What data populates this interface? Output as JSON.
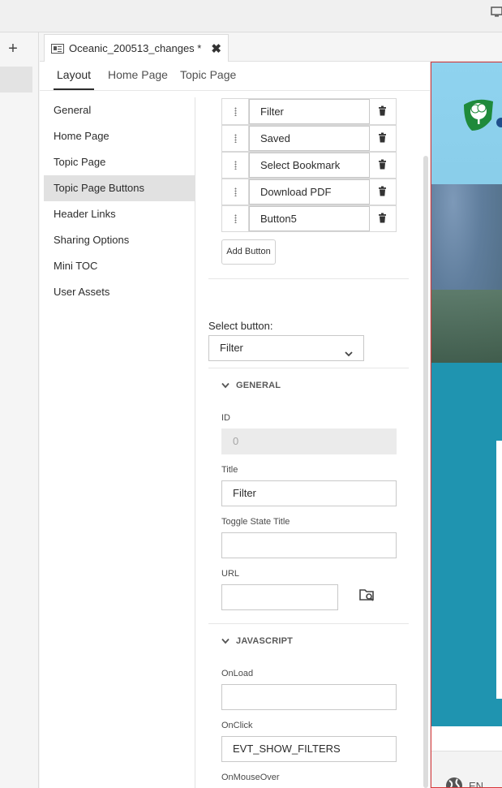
{
  "doc_tab": {
    "title": "Oceanic_200513_changes *",
    "close_label": "✖"
  },
  "subtabs": [
    {
      "label": "Layout",
      "active": true
    },
    {
      "label": "Home Page",
      "active": false
    },
    {
      "label": "Topic Page",
      "active": false
    }
  ],
  "leftnav": {
    "items": [
      {
        "label": "General",
        "active": false
      },
      {
        "label": "Home Page",
        "active": false
      },
      {
        "label": "Topic Page",
        "active": false
      },
      {
        "label": "Topic Page Buttons",
        "active": true
      },
      {
        "label": "Header Links",
        "active": false
      },
      {
        "label": "Sharing Options",
        "active": false
      },
      {
        "label": "Mini TOC",
        "active": false
      },
      {
        "label": "User Assets",
        "active": false
      }
    ]
  },
  "buttons": [
    {
      "label": "Filter"
    },
    {
      "label": "Saved"
    },
    {
      "label": "Select Bookmark"
    },
    {
      "label": "Download PDF"
    },
    {
      "label": "Button5"
    }
  ],
  "add_button_label": "Add Button",
  "select_button": {
    "label": "Select button:",
    "value": "Filter"
  },
  "general_section": {
    "heading": "GENERAL",
    "id_label": "ID",
    "id_value": "0",
    "title_label": "Title",
    "title_value": "Filter",
    "toggle_state_title_label": "Toggle State Title",
    "toggle_state_title_value": "",
    "url_label": "URL",
    "url_value": ""
  },
  "javascript_section": {
    "heading": "JAVASCRIPT",
    "onload_label": "OnLoad",
    "onload_value": "",
    "onclick_label": "OnClick",
    "onclick_value": "EVT_SHOW_FILTERS",
    "onmouseover_label": "OnMouseOver",
    "onmouseover_value": ""
  },
  "preview": {
    "language": "EN"
  },
  "colors": {
    "accent_band": "#1f94b0",
    "preview_border": "#d8373a",
    "selected_nav": "#e1e1e1"
  },
  "icons": {
    "document": "document-icon",
    "close": "close-icon",
    "trash": "trash-icon",
    "grip": "drag-handle-icon",
    "chevron": "chevron-down-icon",
    "browse": "browse-folder-icon",
    "globe": "globe-icon",
    "monitor": "monitor-icon",
    "plus": "plus-icon"
  }
}
